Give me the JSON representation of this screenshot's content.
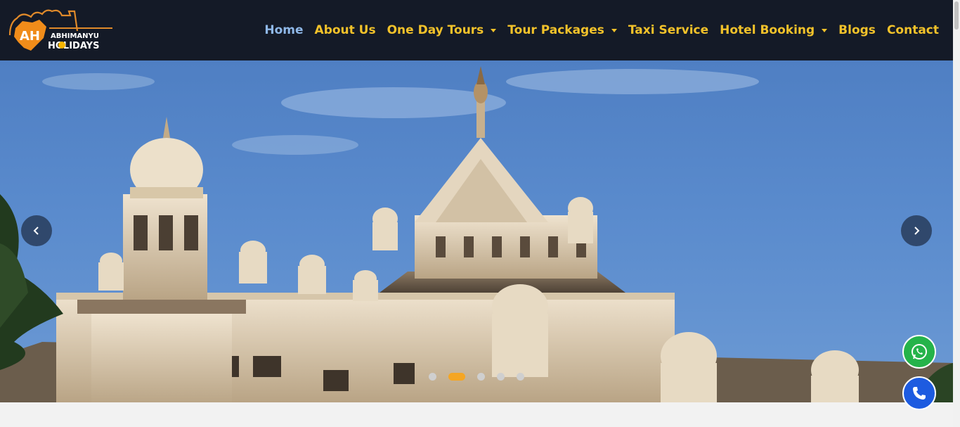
{
  "brand": {
    "logo_initials": "AH",
    "logo_line1": "ABHIMANYU",
    "logo_line2": "HOLIDAYS"
  },
  "nav": {
    "items": [
      {
        "label": "Home",
        "active": true,
        "dropdown": false
      },
      {
        "label": "About Us",
        "active": false,
        "dropdown": false
      },
      {
        "label": "One Day Tours",
        "active": false,
        "dropdown": true
      },
      {
        "label": "Tour Packages",
        "active": false,
        "dropdown": true
      },
      {
        "label": "Taxi Service",
        "active": false,
        "dropdown": false
      },
      {
        "label": "Hotel Booking",
        "active": false,
        "dropdown": true
      },
      {
        "label": "Blogs",
        "active": false,
        "dropdown": false
      },
      {
        "label": "Contact",
        "active": false,
        "dropdown": false
      }
    ]
  },
  "hero": {
    "slide_count": 5,
    "active_slide": 2,
    "prev_icon": "chevron-left-icon",
    "next_icon": "chevron-right-icon"
  },
  "floating": {
    "whatsapp_icon": "whatsapp-icon",
    "call_icon": "phone-icon"
  },
  "colors": {
    "header_bg": "#141a27",
    "nav_text": "#f2c22a",
    "nav_active": "#8fb8e8",
    "dot_active": "#f5a623",
    "whatsapp": "#25b34a",
    "call": "#1d5be0"
  }
}
